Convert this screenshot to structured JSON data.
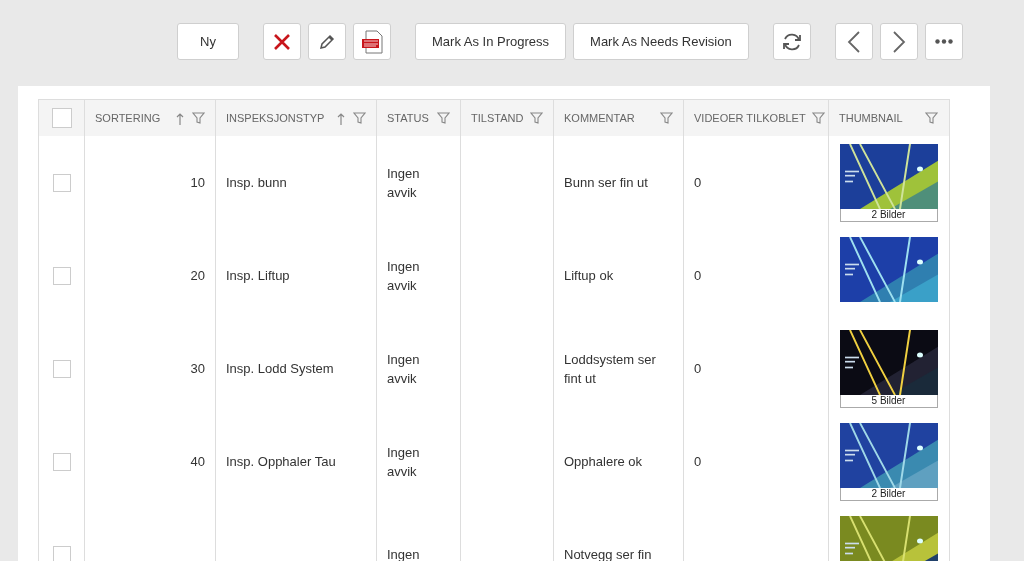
{
  "toolbar": {
    "new_button": "Ny",
    "icon_buttons": [
      {
        "kind": "delete"
      },
      {
        "kind": "edit"
      },
      {
        "kind": "pdf"
      }
    ],
    "text_buttons": [
      "Mark As In Progress",
      "Mark As Needs Revision"
    ],
    "nav_buttons": [
      {
        "kind": "refresh"
      },
      {
        "kind": "prev"
      },
      {
        "kind": "next"
      },
      {
        "kind": "more"
      }
    ]
  },
  "table": {
    "select_all": {
      "checked": false
    },
    "columns": [
      {
        "label": "SORTERING",
        "sorted": true
      },
      {
        "label": "INSPEKSJONSTYP",
        "sorted": true
      },
      {
        "label": "STATUS",
        "sorted": false
      },
      {
        "label": "TILSTAND",
        "sorted": false
      },
      {
        "label": "KOMMENTAR",
        "sorted": false
      },
      {
        "label": "VIDEOER TILKOBLET",
        "sorted": false
      },
      {
        "label": "THUMBNAIL",
        "sorted": false
      }
    ],
    "rows": [
      {
        "checked": false,
        "sortering": "10",
        "type": "Insp. bunn",
        "status": "Ingen avvik",
        "comment": "Bunn ser fin ut",
        "videos": "0",
        "thumbnail": {
          "kind": "picture",
          "caption": "2 Bilder"
        }
      },
      {
        "checked": false,
        "sortering": "20",
        "type": "Insp. Liftup",
        "status": "Ingen avvik",
        "comment": "Liftup ok",
        "videos": "0"
      },
      {
        "checked": false,
        "sortering": "30",
        "type": "Insp. Lodd System",
        "status": "Ingen avvik",
        "comment": "Loddsystem ser fint ut",
        "videos": "0",
        "thumbnail": {
          "kind": "picture",
          "caption": "5 Bilder"
        }
      },
      {
        "checked": false,
        "sortering": "40",
        "type": "Insp. Opphaler Tau",
        "status": "Ingen avvik",
        "comment": "Opphalere ok",
        "videos": "0",
        "thumbnail": {
          "kind": "picture",
          "caption": "2 Bilder"
        }
      },
      {
        "checked": false,
        "status": "Ingen",
        "comment": "Notvegg ser fin"
      }
    ]
  }
}
